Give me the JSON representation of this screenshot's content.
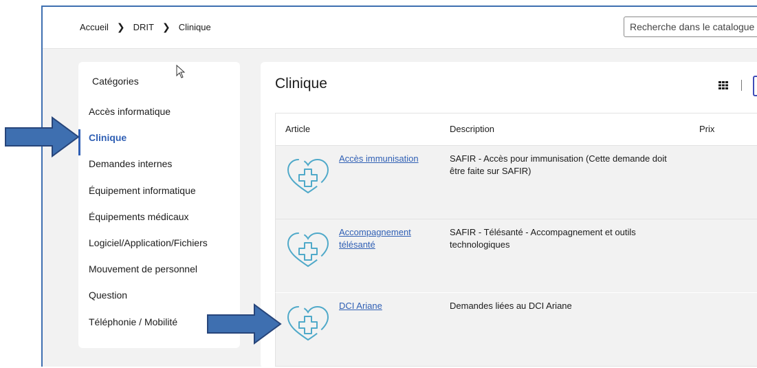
{
  "breadcrumb": [
    "Accueil",
    "DRIT",
    "Clinique"
  ],
  "search": {
    "placeholder": "Recherche dans le catalogue"
  },
  "sidebar": {
    "title": "Catégories",
    "items": [
      {
        "label": "Accès informatique"
      },
      {
        "label": "Clinique",
        "active": true
      },
      {
        "label": "Demandes internes"
      },
      {
        "label": "Équipement informatique"
      },
      {
        "label": "Équipements médicaux"
      },
      {
        "label": "Logiciel/Application/Fichiers"
      },
      {
        "label": "Mouvement de personnel"
      },
      {
        "label": "Question"
      },
      {
        "label": "Téléphonie / Mobilité"
      }
    ]
  },
  "main": {
    "title": "Clinique",
    "view_separator": "|",
    "table": {
      "headers": {
        "article": "Article",
        "description": "Description",
        "price": "Prix"
      },
      "rows": [
        {
          "name": "Accès immunisation",
          "description": "SAFIR - Accès pour immunisation (Cette demande doit être faite sur SAFIR)"
        },
        {
          "name": "Accompagnement télésanté",
          "description": "SAFIR - Télésanté - Accompagnement et outils technologiques"
        },
        {
          "name": "DCI Ariane",
          "description": "Demandes liées au DCI Ariane"
        }
      ]
    }
  },
  "icons": {
    "item_icon": "heart-plus-icon",
    "grid_icon": "grid-view-icon",
    "annotation": "blue-arrow-icon"
  },
  "colors": {
    "accent": "#2f5fb4",
    "icon": "#4fa9c9",
    "arrow_fill": "#3e6fb0",
    "arrow_stroke": "#27457a"
  }
}
